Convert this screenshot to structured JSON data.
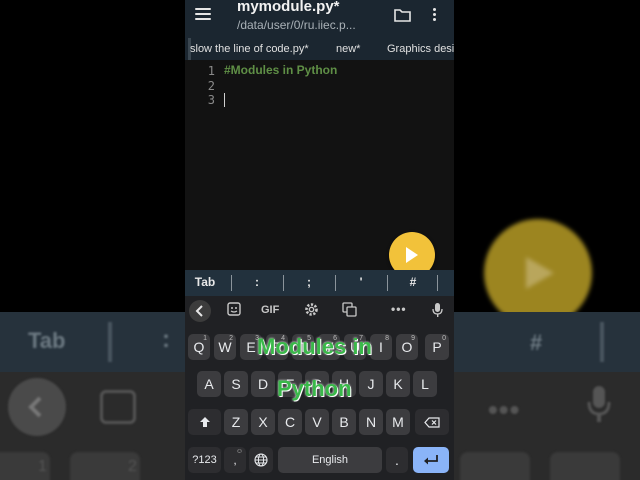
{
  "app": {
    "title": "mymodule.py*",
    "path": "/data/user/0/ru.iiec.p..."
  },
  "tabs": [
    {
      "label": "slow the line of code.py*"
    },
    {
      "label": "new*"
    },
    {
      "label": "Graphics desi"
    }
  ],
  "editor": {
    "line_numbers": [
      "1",
      "2",
      "3"
    ],
    "lines": [
      "#Modules in Python",
      "",
      ""
    ]
  },
  "symbol_bar": {
    "keys": [
      "Tab",
      ":",
      ";",
      "'",
      "#"
    ]
  },
  "keyboard": {
    "toolbar": {
      "gif_label": "GIF",
      "more_label": "•••"
    },
    "row1": [
      {
        "key": "Q",
        "num": "1"
      },
      {
        "key": "W",
        "num": "2"
      },
      {
        "key": "E",
        "num": "3"
      },
      {
        "key": "R",
        "num": "4"
      },
      {
        "key": "T",
        "num": "5"
      },
      {
        "key": "Y",
        "num": "6"
      },
      {
        "key": "U",
        "num": "7"
      },
      {
        "key": "I",
        "num": "8"
      },
      {
        "key": "O",
        "num": "9"
      },
      {
        "key": "P",
        "num": "0"
      }
    ],
    "row2": [
      "A",
      "S",
      "D",
      "F",
      "G",
      "H",
      "J",
      "K",
      "L"
    ],
    "row3": [
      "Z",
      "X",
      "C",
      "V",
      "B",
      "N",
      "M"
    ],
    "bottom": {
      "symbols_label": "?123",
      "comma_label": ",",
      "space_label": "English",
      "period_label": "."
    }
  },
  "overlay_caption": [
    "Modules in",
    "Python"
  ],
  "background_zoom": {
    "tab_label": "Tab",
    "colon": ":",
    "hash": "#",
    "more": "•••",
    "digits": [
      "1",
      "2"
    ]
  },
  "colors": {
    "appbar": "#1b2630",
    "editor_bg": "#121212",
    "comment_text": "#5f8f46",
    "play_button": "#f2c23a",
    "caption_green": "#3ab84a",
    "enter_key": "#8ab4f8"
  }
}
